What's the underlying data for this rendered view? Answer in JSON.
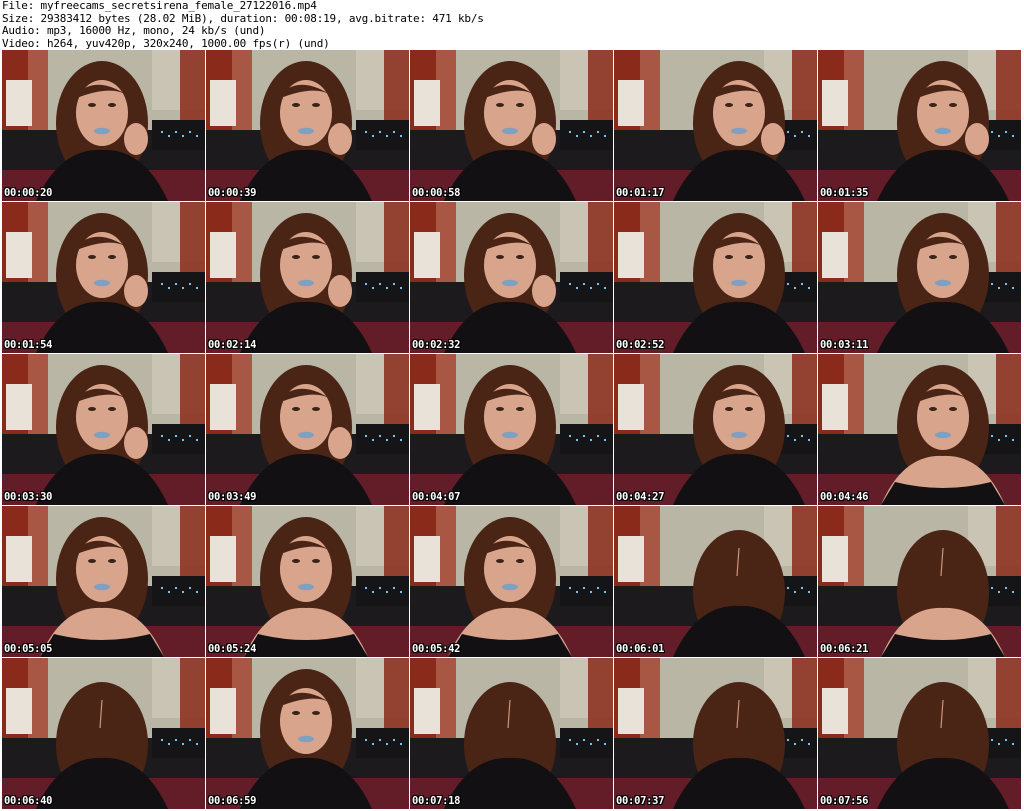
{
  "header": {
    "file_line": "File: myfreecams_secretsirena_female_27122016.mp4",
    "size_line": "Size: 29383412 bytes (28.02 MiB), duration: 00:08:19, avg.bitrate: 471 kb/s",
    "audio_line": "Audio: mp3, 16000 Hz, mono, 24 kb/s (und)",
    "video_line": "Video: h264, yuv420p, 320x240, 1000.00 fps(r) (und)"
  },
  "colors": {
    "curtain": "#8a2a1a",
    "wall": "#b9b6a6",
    "sofa": "#1c1a1c",
    "hair": "#4a2516",
    "skin": "#d9a48c",
    "lips": "#7fa0c0",
    "clothing": "#121012",
    "blanket": "#6e1f2a"
  },
  "thumbnails": [
    {
      "time": "00:00:20",
      "pose": "center",
      "hand": true,
      "bare": false,
      "down": false
    },
    {
      "time": "00:00:39",
      "pose": "center",
      "hand": true,
      "bare": false,
      "down": false
    },
    {
      "time": "00:00:58",
      "pose": "center",
      "hand": true,
      "bare": false,
      "down": false
    },
    {
      "time": "00:01:17",
      "pose": "right",
      "hand": true,
      "bare": false,
      "down": false
    },
    {
      "time": "00:01:35",
      "pose": "right",
      "hand": true,
      "bare": false,
      "down": false
    },
    {
      "time": "00:01:54",
      "pose": "center",
      "hand": true,
      "bare": false,
      "down": false
    },
    {
      "time": "00:02:14",
      "pose": "center",
      "hand": true,
      "bare": false,
      "down": false
    },
    {
      "time": "00:02:32",
      "pose": "center",
      "hand": true,
      "bare": false,
      "down": false
    },
    {
      "time": "00:02:52",
      "pose": "right",
      "hand": false,
      "bare": false,
      "down": false
    },
    {
      "time": "00:03:11",
      "pose": "right",
      "hand": false,
      "bare": false,
      "down": false
    },
    {
      "time": "00:03:30",
      "pose": "center",
      "hand": true,
      "bare": false,
      "down": false
    },
    {
      "time": "00:03:49",
      "pose": "center",
      "hand": true,
      "bare": false,
      "down": false
    },
    {
      "time": "00:04:07",
      "pose": "center",
      "hand": false,
      "bare": false,
      "down": false
    },
    {
      "time": "00:04:27",
      "pose": "right",
      "hand": false,
      "bare": false,
      "down": false
    },
    {
      "time": "00:04:46",
      "pose": "right",
      "hand": false,
      "bare": true,
      "down": false
    },
    {
      "time": "00:05:05",
      "pose": "center",
      "hand": false,
      "bare": true,
      "down": false
    },
    {
      "time": "00:05:24",
      "pose": "center",
      "hand": false,
      "bare": true,
      "down": false
    },
    {
      "time": "00:05:42",
      "pose": "center",
      "hand": false,
      "bare": true,
      "down": false
    },
    {
      "time": "00:06:01",
      "pose": "right",
      "hand": false,
      "bare": false,
      "down": true
    },
    {
      "time": "00:06:21",
      "pose": "right",
      "hand": false,
      "bare": true,
      "down": true
    },
    {
      "time": "00:06:40",
      "pose": "center",
      "hand": false,
      "bare": false,
      "down": true
    },
    {
      "time": "00:06:59",
      "pose": "center",
      "hand": false,
      "bare": false,
      "down": false
    },
    {
      "time": "00:07:18",
      "pose": "center",
      "hand": false,
      "bare": false,
      "down": true
    },
    {
      "time": "00:07:37",
      "pose": "right",
      "hand": false,
      "bare": false,
      "down": true
    },
    {
      "time": "00:07:56",
      "pose": "right",
      "hand": false,
      "bare": false,
      "down": true
    }
  ]
}
